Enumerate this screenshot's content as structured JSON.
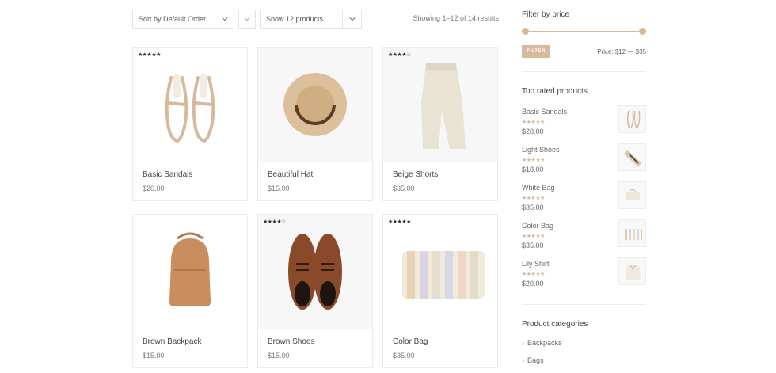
{
  "toolbar": {
    "sort_label": "Sort by Default Order",
    "show_label": "Show 12 products",
    "result_count": "Showing 1–12 of 14 results"
  },
  "products": [
    {
      "title": "Basic Sandals",
      "price": "$20.00",
      "stars": "★★★★★",
      "rating": 5
    },
    {
      "title": "Beautiful Hat",
      "price": "$15.00",
      "stars": "",
      "rating": 0
    },
    {
      "title": "Beige Shorts",
      "price": "$35.00",
      "stars": "★★★★☆",
      "rating": 4
    },
    {
      "title": "Brown Backpack",
      "price": "$15.00",
      "stars": "",
      "rating": 0
    },
    {
      "title": "Brown Shoes",
      "price": "$15.00",
      "stars": "★★★★☆",
      "rating": 4
    },
    {
      "title": "Color Bag",
      "price": "$35.00",
      "stars": "★★★★★",
      "rating": 4.5
    }
  ],
  "sidebar": {
    "price_filter": {
      "title": "Filter by price",
      "button_label": "FILTER",
      "range_text": "Price: $12 — $35"
    },
    "top_rated": {
      "title": "Top rated products",
      "items": [
        {
          "name": "Basic Sandals",
          "stars": "★★★★★",
          "price": "$20.00"
        },
        {
          "name": "Light Shoes",
          "stars": "★★★★★",
          "price": "$18.00"
        },
        {
          "name": "White Bag",
          "stars": "★★★★★",
          "price": "$35.00"
        },
        {
          "name": "Color Bag",
          "stars": "★★★★★",
          "price": "$35.00"
        },
        {
          "name": "Lily Shirt",
          "stars": "★★★★★",
          "price": "$20.00"
        }
      ]
    },
    "categories": {
      "title": "Product categories",
      "items": [
        "Backpacks",
        "Bags"
      ]
    }
  },
  "colors": {
    "accent": "#d7b99c",
    "border": "#ececec",
    "text": "#444444"
  }
}
